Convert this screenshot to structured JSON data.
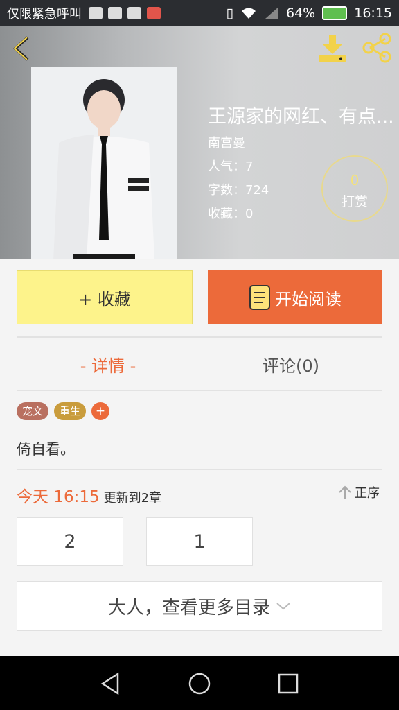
{
  "status_bar": {
    "carrier_text": "仅限紧急呼叫",
    "battery_percent": "64%",
    "time": "16:15"
  },
  "book": {
    "title": "王源家的网红、有点...",
    "author": "南宫曼",
    "popularity_label": "人气：",
    "popularity_value": "7",
    "word_count_label": "字数：",
    "word_count_value": "724",
    "favorites_label": "收藏：",
    "favorites_value": "0"
  },
  "reward": {
    "count": "0",
    "label": "打赏"
  },
  "actions": {
    "favorite_label": "+ 收藏",
    "read_label": "开始阅读"
  },
  "tabs": [
    {
      "label": "- 详情 -",
      "active": true
    },
    {
      "label": "评论(0)",
      "active": false
    }
  ],
  "tags": [
    {
      "label": "宠文",
      "color": "#b97060"
    },
    {
      "label": "重生",
      "color": "#c99c3c"
    }
  ],
  "tag_add_label": "+",
  "description": "倚自看。",
  "update": {
    "time": "今天 16:15",
    "text": "更新到2章",
    "sort_label": "正序"
  },
  "chapters": [
    "2",
    "1"
  ],
  "more_catalog_label": "大人，查看更多目录",
  "colors": {
    "accent": "#ec6a3a",
    "favorite_bg": "#fdf38b",
    "page_bg": "#f4f4f4"
  },
  "icons": [
    "back-icon",
    "download-icon",
    "share-icon",
    "book-icon",
    "arrow-up-icon",
    "chevron-down-icon",
    "nav-back-icon",
    "nav-home-icon",
    "nav-recent-icon"
  ]
}
